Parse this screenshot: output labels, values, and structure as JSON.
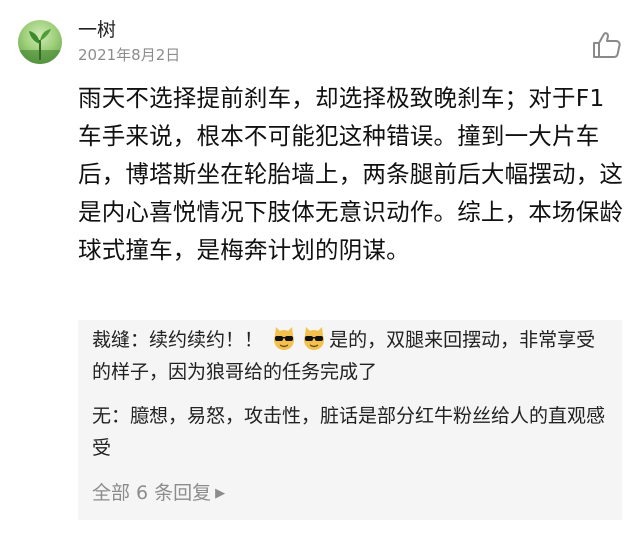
{
  "post": {
    "author": "一树",
    "date": "2021年8月2日",
    "like_icon": "thumbs-up-icon",
    "body": "雨天不选择提前刹车，却选择极致晚刹车；对于F1车手来说，根本不可能犯这种错误。撞到一大片车后，博塔斯坐在轮胎墙上，两条腿前后大幅摆动，这是内心喜悦情况下肢体无意识动作。综上，本场保龄球式撞车，是梅奔计划的阴谋。"
  },
  "replies": [
    {
      "name": "裁缝",
      "separator": "：",
      "text_before_emoji": "续约续约！！",
      "emojis": [
        "cool-cat-emoji",
        "cool-cat-emoji"
      ],
      "text_after_emoji": "是的，双腿来回摆动，非常享受的样子，因为狼哥给的任务完成了"
    },
    {
      "name": "无",
      "separator": "：",
      "text": "臆想，易怒，攻击性，脏话是部分红牛粉丝给人的直观感受"
    }
  ],
  "more_replies": {
    "label": "全部 6 条回复",
    "icon": "caret-right-icon"
  },
  "colors": {
    "text": "#111111",
    "secondary_text": "#8c8c8c",
    "reply_background": "#f5f5f5"
  }
}
